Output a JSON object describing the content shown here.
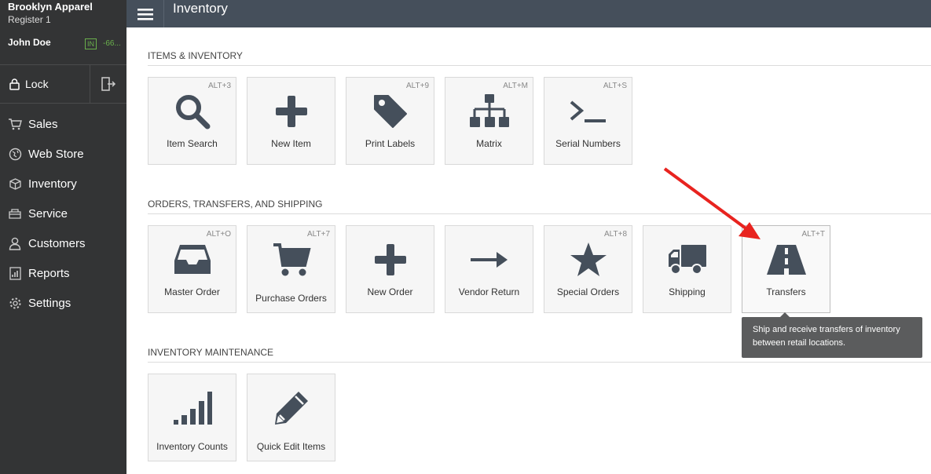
{
  "sidebar": {
    "store_name": "Brooklyn Apparel",
    "register": "Register 1",
    "user_name": "John Doe",
    "clock_status": "IN",
    "clock_time": "-66...",
    "lock_label": "Lock",
    "nav": [
      {
        "label": "Sales",
        "icon": "cart-icon"
      },
      {
        "label": "Web Store",
        "icon": "globe-icon"
      },
      {
        "label": "Inventory",
        "icon": "box-icon"
      },
      {
        "label": "Service",
        "icon": "service-icon"
      },
      {
        "label": "Customers",
        "icon": "person-icon"
      },
      {
        "label": "Reports",
        "icon": "reports-icon"
      },
      {
        "label": "Settings",
        "icon": "gear-icon"
      }
    ]
  },
  "header": {
    "title": "Inventory"
  },
  "sections": [
    {
      "title": "ITEMS & INVENTORY",
      "tiles": [
        {
          "label": "Item Search",
          "shortcut": "ALT+3",
          "icon": "search-icon"
        },
        {
          "label": "New Item",
          "shortcut": "",
          "icon": "plus-icon"
        },
        {
          "label": "Print Labels",
          "shortcut": "ALT+9",
          "icon": "tag-icon"
        },
        {
          "label": "Matrix",
          "shortcut": "ALT+M",
          "icon": "matrix-icon"
        },
        {
          "label": "Serial Numbers",
          "shortcut": "ALT+S",
          "icon": "terminal-icon"
        }
      ]
    },
    {
      "title": "ORDERS, TRANSFERS, AND SHIPPING",
      "tiles": [
        {
          "label": "Master Order",
          "shortcut": "ALT+O",
          "icon": "inbox-icon"
        },
        {
          "label": "Purchase Orders",
          "shortcut": "ALT+7",
          "icon": "cart-icon"
        },
        {
          "label": "New Order",
          "shortcut": "",
          "icon": "plus-icon"
        },
        {
          "label": "Vendor Return",
          "shortcut": "",
          "icon": "arrow-right-icon"
        },
        {
          "label": "Special Orders",
          "shortcut": "ALT+8",
          "icon": "star-icon"
        },
        {
          "label": "Shipping",
          "shortcut": "",
          "icon": "truck-icon"
        },
        {
          "label": "Transfers",
          "shortcut": "ALT+T",
          "icon": "road-icon"
        }
      ]
    },
    {
      "title": "INVENTORY MAINTENANCE",
      "tiles": [
        {
          "label": "Inventory Counts",
          "shortcut": "",
          "icon": "bars-icon"
        },
        {
          "label": "Quick Edit Items",
          "shortcut": "",
          "icon": "pencil-icon"
        }
      ]
    }
  ],
  "tooltip": {
    "line1": "Ship and receive transfers of inventory",
    "line2": "between retail locations."
  },
  "colors": {
    "sidebar_bg": "#333435",
    "header_bg": "#454f5b",
    "icon": "#454f5b",
    "accent_green": "#6ab04c",
    "annotation_red": "#e8231f"
  }
}
